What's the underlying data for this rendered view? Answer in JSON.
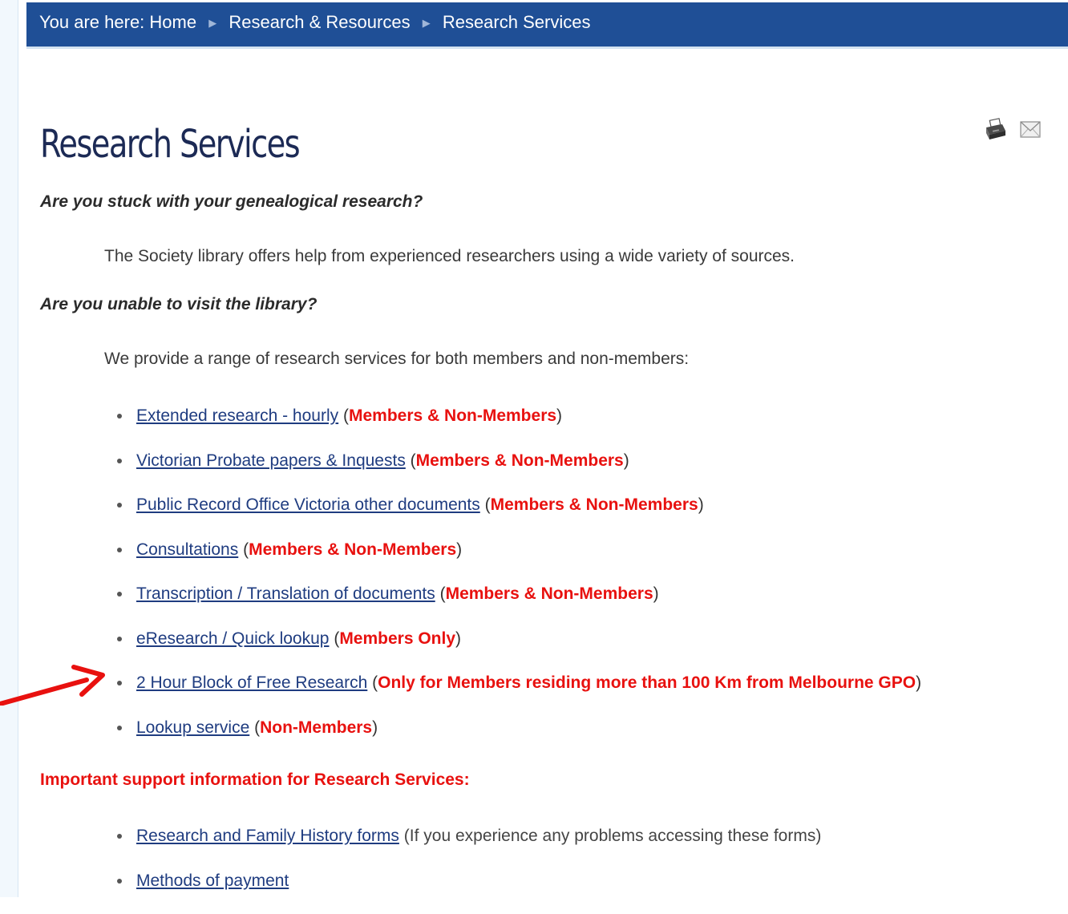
{
  "breadcrumb": {
    "prefix": "You are here:",
    "items": [
      "Home",
      "Research & Resources",
      "Research Services"
    ]
  },
  "page": {
    "title": "Research Services"
  },
  "tools": {
    "print_icon": "printer-icon",
    "email_icon": "envelope-icon"
  },
  "intro": {
    "q1": "Are you stuck with your genealogical research?",
    "p1": "The Society library offers help from experienced researchers using a wide variety of sources.",
    "q2": "Are you unable to visit the library?",
    "p2": "We provide a range of research services for both members and non-members:"
  },
  "services": [
    {
      "label": "Extended research - hourly",
      "audience": "Members & Non-Members"
    },
    {
      "label": "Victorian Probate papers & Inquests",
      "audience": "Members & Non-Members"
    },
    {
      "label": "Public Record Office Victoria other documents",
      "audience": "Members & Non-Members"
    },
    {
      "label": "Consultations",
      "audience": "Members & Non-Members"
    },
    {
      "label": "Transcription / Translation of documents",
      "audience": "Members & Non-Members"
    },
    {
      "label": "eResearch / Quick lookup",
      "audience": "Members Only"
    },
    {
      "label": "2 Hour Block of Free Research",
      "audience": "Only for Members residing more than 100 Km from Melbourne GPO"
    },
    {
      "label": "Lookup service",
      "audience": "Non-Members"
    }
  ],
  "support": {
    "heading": "Important support information for Research Services:",
    "items": [
      {
        "label": "Research and Family History forms",
        "note": "(If you experience any problems accessing these forms)"
      },
      {
        "label": "Methods of payment",
        "note": ""
      }
    ]
  },
  "colors": {
    "breadcrumb_bg": "#1f4f96",
    "title": "#1c2a55",
    "link": "#1f3c80",
    "highlight_red": "#e8110f",
    "arrow": "#e8110f"
  }
}
